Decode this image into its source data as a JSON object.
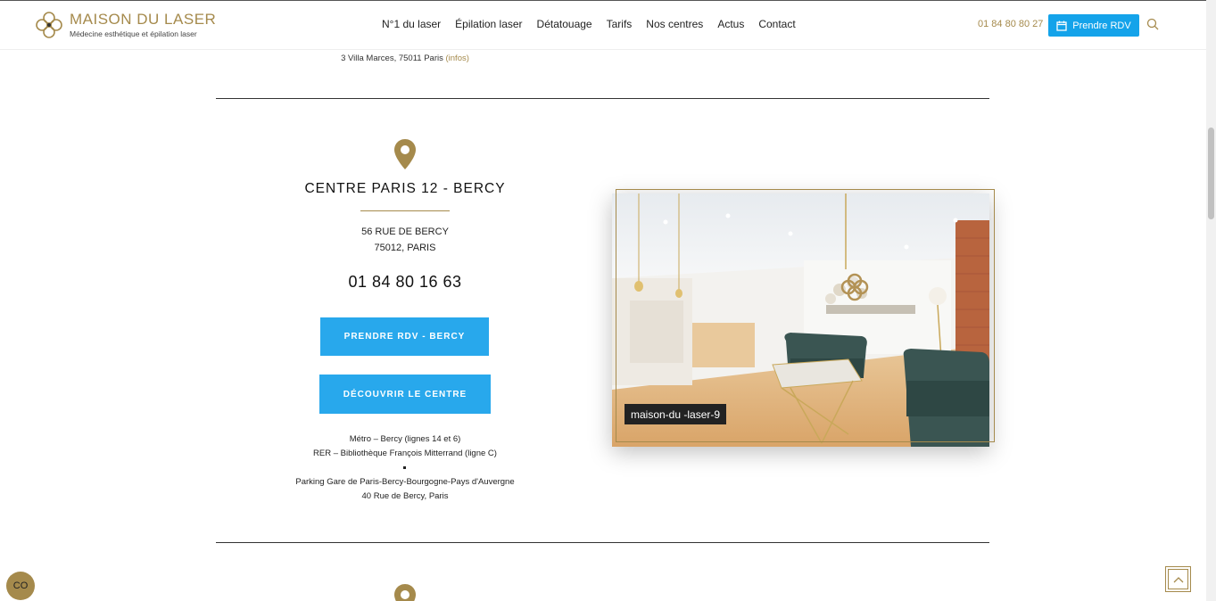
{
  "brand": {
    "name": "MAISON DU LASER",
    "tagline": "Médecine esthétique et épilation laser",
    "gold": "#a58a4c",
    "blue": "#14a3ea"
  },
  "nav": {
    "items": [
      "N°1 du laser",
      "Épilation laser",
      "Détatouage",
      "Tarifs",
      "Nos centres",
      "Actus",
      "Contact"
    ],
    "phone": "01 84 80 80 27",
    "rdv_label": "Prendre RDV"
  },
  "previous_center": {
    "address": "3 Villa Marces, 75011 Paris",
    "infos_label": "(infos)"
  },
  "center": {
    "title": "CENTRE PARIS 12 - BERCY",
    "street": "56 RUE DE BERCY",
    "city": "75012, PARIS",
    "phone": "01 84 80 16 63",
    "rdv_button": "PRENDRE RDV - BERCY",
    "discover_button": "DÉCOUVRIR LE CENTRE",
    "metro": "Métro – Bercy (lignes 14 et 6)",
    "rer": "RER – Bibliothèque François Mitterrand (ligne C)",
    "parking_name": "Parking Gare de Paris-Bercy-Bourgogne-Pays d'Auvergne",
    "parking_address": "40 Rue de Bercy, Paris",
    "photo_caption": "maison-du -laser-9"
  },
  "widgets": {
    "cookie_label": "CO"
  }
}
